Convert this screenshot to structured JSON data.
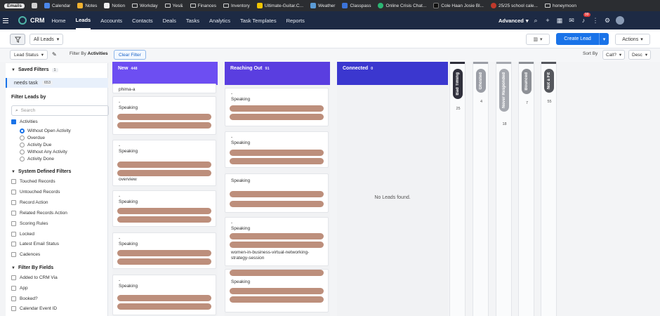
{
  "bookmarks": [
    {
      "label": "Emails",
      "icon": "emails-icon",
      "color": "#e8e8e8"
    },
    {
      "label": "",
      "icon": "apps-grid-icon",
      "color": "#cfcfcf"
    },
    {
      "label": "Calendar",
      "icon": "calendar-icon",
      "color": "#4a86e8"
    },
    {
      "label": "Notes",
      "icon": "notes-icon",
      "color": "#f2b230"
    },
    {
      "label": "Notion",
      "icon": "notion-icon",
      "color": "#eeeeee"
    },
    {
      "label": "Workday",
      "icon": "folder-icon",
      "color": ""
    },
    {
      "label": "Yes&",
      "icon": "folder-icon",
      "color": ""
    },
    {
      "label": "Finances",
      "icon": "folder-icon",
      "color": ""
    },
    {
      "label": "Inventory",
      "icon": "folder-icon",
      "color": ""
    },
    {
      "label": "Ultimate-Guitar.C...",
      "icon": "guitar-icon",
      "color": "#f2c500"
    },
    {
      "label": "Weather",
      "icon": "weather-icon",
      "color": "#5b9bd5"
    },
    {
      "label": "Classpass",
      "icon": "classpass-icon",
      "color": "#3b73d9"
    },
    {
      "label": "Online Crisis Chat...",
      "icon": "chat-icon",
      "color": "#2bb673"
    },
    {
      "label": "Cole Haan Josie Bl...",
      "icon": "cole-haan-icon",
      "color": "#111111"
    },
    {
      "label": "25/25 school cale...",
      "icon": "school-icon",
      "color": "#c0392b"
    },
    {
      "label": "honeymoon",
      "icon": "folder-icon",
      "color": ""
    }
  ],
  "header": {
    "brand": "CRM",
    "nav": [
      "Home",
      "Leads",
      "Accounts",
      "Contacts",
      "Deals",
      "Tasks",
      "Analytics",
      "Task Templates",
      "Reports"
    ],
    "active_nav": "Leads",
    "advanced_label": "Advanced",
    "notification_count": "99"
  },
  "toolbar": {
    "view_label": "All Leads",
    "create_label": "Create Lead",
    "actions_label": "Actions"
  },
  "filterbar": {
    "lead_status_label": "Lead Status",
    "filter_by_prefix": "Filter By",
    "filter_by_value": "Activities",
    "clear_filter_label": "Clear Filter",
    "sort_by_label": "Sort By",
    "sort_field": "Call?",
    "sort_order": "Desc"
  },
  "sidebar": {
    "saved_filters_title": "Saved Filters",
    "saved_filters_count": "1",
    "saved_item_label": "needs task",
    "saved_item_count": "653",
    "filter_leads_by_title": "Filter Leads by",
    "search_placeholder": "Search",
    "activities_label": "Activities",
    "activity_options": [
      "Without Open Activity",
      "Overdue",
      "Activity Due",
      "Without Any Activity",
      "Activity Done"
    ],
    "system_filters_title": "System Defined Filters",
    "system_filters": [
      "Touched Records",
      "Untouched Records",
      "Record Action",
      "Related Records Action",
      "Scoring Rules",
      "Locked",
      "Latest Email Status",
      "Cadences"
    ],
    "field_filters_title": "Filter By Fields",
    "field_filters": [
      "Added to CRM Via",
      "App",
      "Booked?",
      "Calendar Event ID"
    ]
  },
  "columns": [
    {
      "name": "New",
      "count": "448",
      "color": "#6d4ef2"
    },
    {
      "name": "Reaching Out",
      "count": "91",
      "color": "#5a3ee0"
    },
    {
      "name": "Connected",
      "count": "0",
      "color": "#3b37cf",
      "empty_text": "No Leads found."
    }
  ],
  "new_cards": [
    {
      "dash": "",
      "text": "phima-a"
    },
    {
      "dash": "-",
      "text": "Speaking"
    },
    {
      "dash": "-",
      "text": "Speaking",
      "extra": "overview"
    },
    {
      "dash": "-",
      "text": "Speaking"
    },
    {
      "dash": "-",
      "text": "Speaking"
    },
    {
      "dash": "-",
      "text": "Speaking"
    }
  ],
  "reaching_cards": [
    {
      "dash": "-",
      "text": "Speaking"
    },
    {
      "dash": "-",
      "text": "Speaking"
    },
    {
      "dash": "",
      "text": "Speaking"
    },
    {
      "dash": "-",
      "text": "Speaking",
      "extra": "women-in-business-virtual-networking-strategy-session"
    },
    {
      "dash": "",
      "text": "Speaking"
    }
  ],
  "collapsed_columns": [
    {
      "name": "Bad Timing",
      "count": "25",
      "color": "#2f2f3b"
    },
    {
      "name": "Ghosted",
      "count": "4",
      "color": "#9b9ea6"
    },
    {
      "name": "Never Responded",
      "count": "18",
      "color": "#a6a9b0"
    },
    {
      "name": "Bounced",
      "count": "7",
      "color": "#8d9096"
    },
    {
      "name": "Not a Fit",
      "count": "55",
      "color": "#55575d"
    }
  ]
}
